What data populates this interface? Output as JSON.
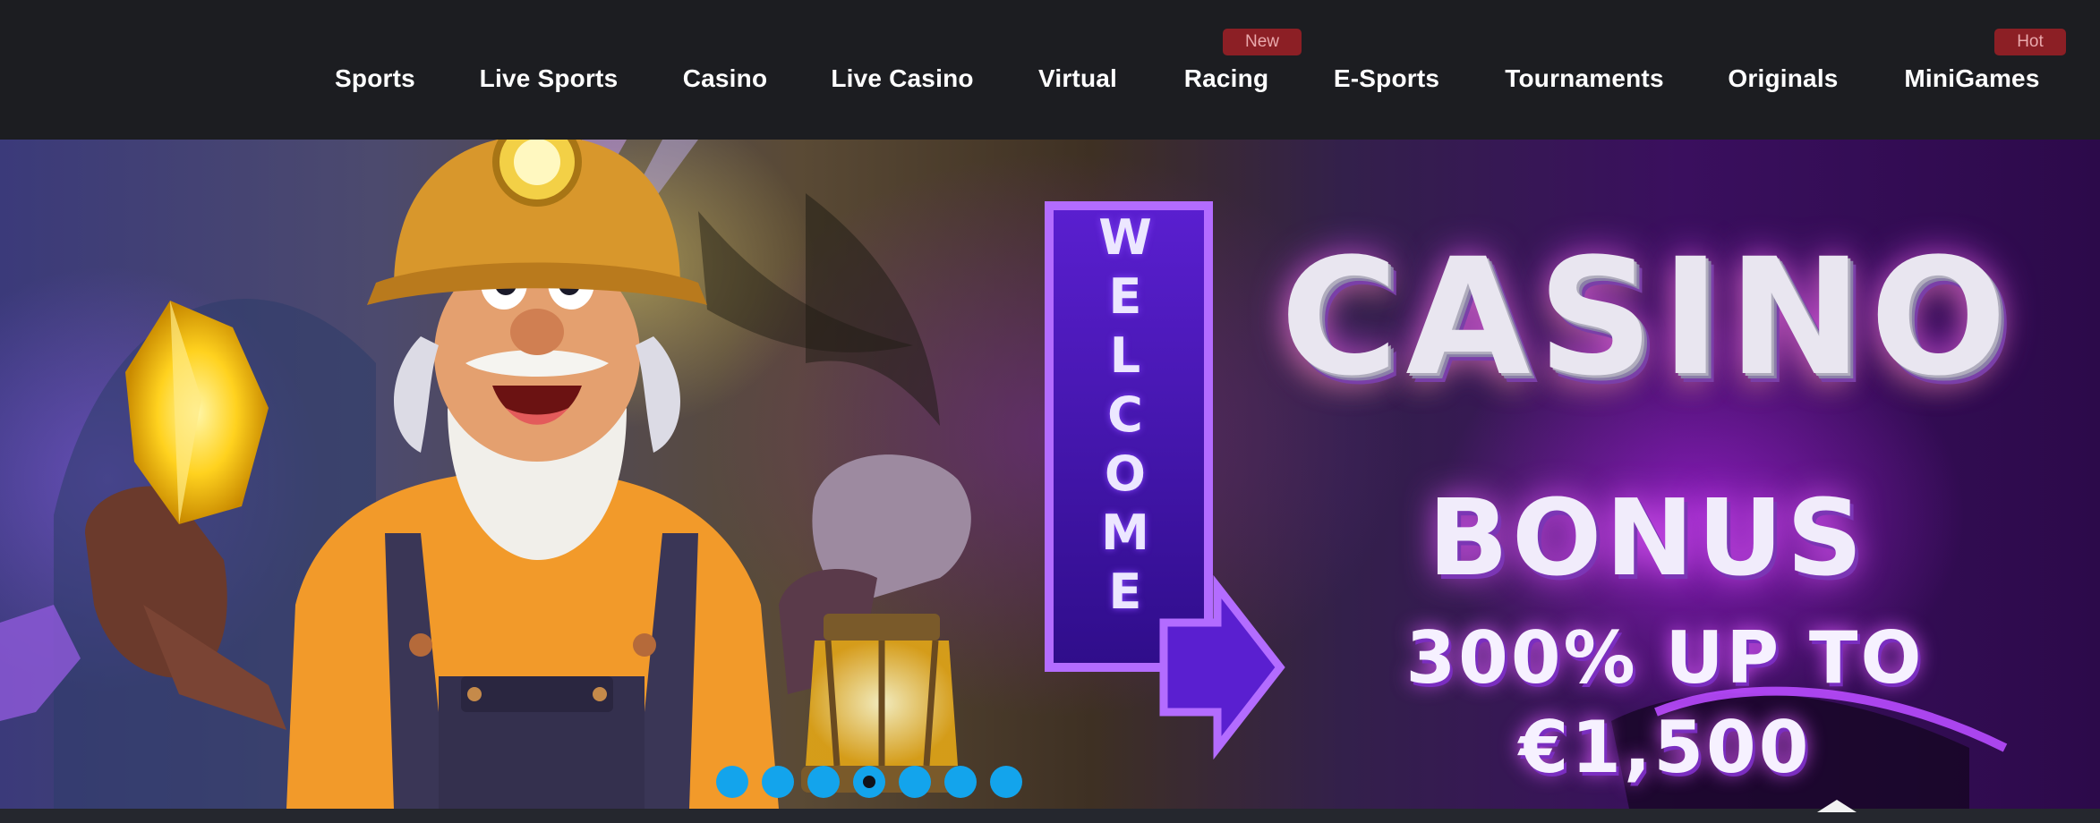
{
  "nav": {
    "items": [
      {
        "label": "Sports"
      },
      {
        "label": "Live Sports"
      },
      {
        "label": "Casino"
      },
      {
        "label": "Live Casino"
      },
      {
        "label": "Virtual"
      },
      {
        "label": "Racing",
        "badge": "New"
      },
      {
        "label": "E-Sports"
      },
      {
        "label": "Tournaments"
      },
      {
        "label": "Originals"
      },
      {
        "label": "MiniGames",
        "badge": "Hot"
      }
    ]
  },
  "banner": {
    "sign_letters": [
      "W",
      "E",
      "L",
      "C",
      "O",
      "M",
      "E"
    ],
    "headline": "CASINO",
    "subheadline": "BONUS",
    "offer": "300% UP TO €1,500",
    "slide_count": 7,
    "active_slide_index": 3
  },
  "colors": {
    "nav_bg": "#1c1d21",
    "badge_bg": "#8c1f25",
    "dot": "#13a4ec",
    "accent_purple": "#c528ff"
  }
}
